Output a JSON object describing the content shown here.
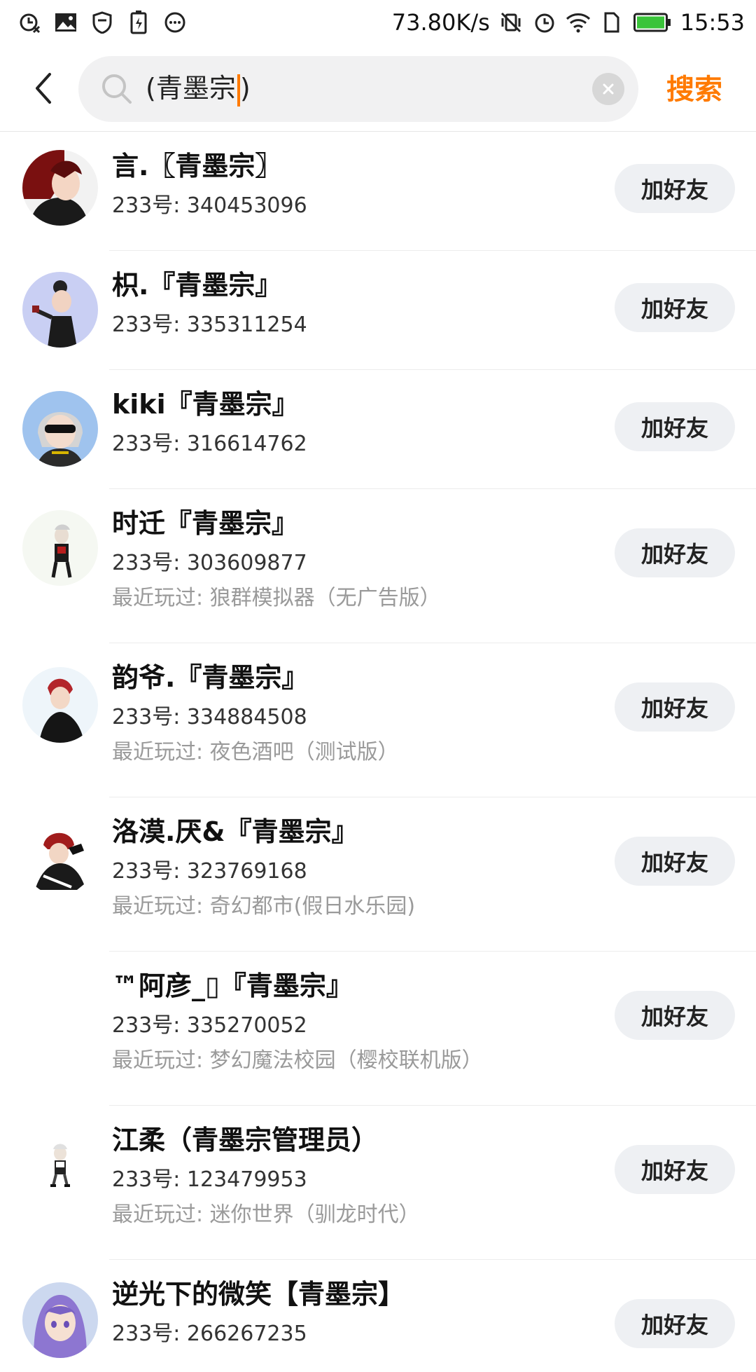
{
  "status_bar": {
    "left_icons": [
      "alarm-off-icon",
      "image-icon",
      "shield-icon",
      "battery-saver-icon",
      "more-dots-icon"
    ],
    "net_speed": "73.80K/s",
    "time": "15:53",
    "battery_color": "#3ac43a"
  },
  "search": {
    "query": "(青墨宗",
    "query_tail": ")",
    "submit_label": "搜索",
    "accent_color": "#ff7a00"
  },
  "results": [
    {
      "name": "言.〖青墨宗〗",
      "uid": "233号: 340453096",
      "recent": "",
      "add_label": "加好友"
    },
    {
      "name": "枳.『青墨宗』",
      "uid": "233号: 335311254",
      "recent": "",
      "add_label": "加好友"
    },
    {
      "name": "kiki『青墨宗』",
      "uid": "233号: 316614762",
      "recent": "",
      "add_label": "加好友"
    },
    {
      "name": "时迁『青墨宗』",
      "uid": "233号: 303609877",
      "recent": "最近玩过: 狼群模拟器（无广告版）",
      "add_label": "加好友"
    },
    {
      "name": "韵爷.『青墨宗』",
      "uid": "233号: 334884508",
      "recent": "最近玩过: 夜色酒吧（测试版）",
      "add_label": "加好友"
    },
    {
      "name": "洛漠.厌&『青墨宗』",
      "uid": "233号: 323769168",
      "recent": "最近玩过: 奇幻都市(假日水乐园)",
      "add_label": "加好友"
    },
    {
      "name": "™阿彦_▯『青墨宗』",
      "uid": "233号: 335270052",
      "recent": "最近玩过: 梦幻魔法校园（樱校联机版）",
      "add_label": "加好友"
    },
    {
      "name": "江柔（青墨宗管理员）",
      "uid": "233号: 123479953",
      "recent": "最近玩过: 迷你世界（驯龙时代）",
      "add_label": "加好友"
    },
    {
      "name": "逆光下的微笑【青墨宗】",
      "uid": "233号: 266267235",
      "recent": "",
      "add_label": "加好友"
    }
  ]
}
